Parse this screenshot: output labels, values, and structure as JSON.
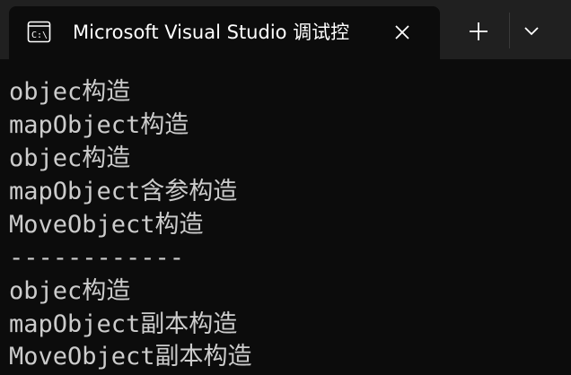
{
  "window": {
    "tab_title": "Microsoft Visual Studio 调试控",
    "tab_icon": "console-app-icon",
    "close_icon": "close-icon",
    "new_tab_icon": "plus-icon",
    "dropdown_icon": "chevron-down-icon"
  },
  "console": {
    "lines": [
      "objec构造",
      "mapObject构造",
      "objec构造",
      "mapObject含参构造",
      "MoveObject构造",
      "------------",
      "objec构造",
      "mapObject副本构造",
      "MoveObject副本构造"
    ]
  },
  "colors": {
    "titlebar_bg": "#202020",
    "console_bg": "#0c0c0c",
    "console_text": "#cccccc",
    "title_text": "#ffffff"
  }
}
